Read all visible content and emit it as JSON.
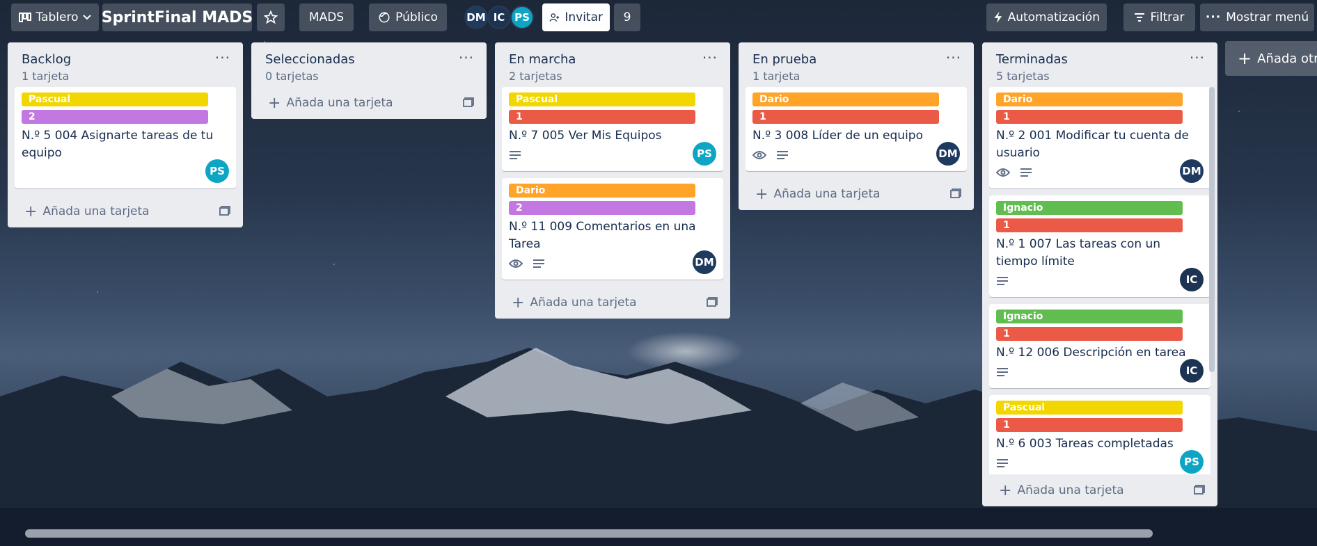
{
  "header": {
    "view_label": "Tablero",
    "board_title": "SprintFinal MADS",
    "workspace": "MADS",
    "visibility": "Público",
    "members": [
      {
        "initials": "DM",
        "color": "#1f3a5f"
      },
      {
        "initials": "IC",
        "color": "#1c3452"
      },
      {
        "initials": "PS",
        "color": "#0ea5c4"
      }
    ],
    "invite_label": "Invitar",
    "member_count": "9",
    "automation_label": "Automatización",
    "filter_label": "Filtrar",
    "menu_label": "Mostrar menú"
  },
  "add_list_label": "Añada otra",
  "add_card_label": "Añada una tarjeta",
  "label_colors": {
    "yellow": "#f2d600",
    "purple": "#c377e0",
    "red": "#eb5a46",
    "orange": "#ffa428",
    "green": "#61bd4f"
  },
  "lists": [
    {
      "title": "Backlog",
      "count": "1 tarjeta",
      "cards": [
        {
          "labels": [
            {
              "text": "Pascual",
              "color": "yellow"
            },
            {
              "text": "2",
              "color": "purple"
            }
          ],
          "title": "N.º 5 004 Asignarte tareas de tu equipo",
          "badges": [],
          "avatar": "PS"
        }
      ]
    },
    {
      "title": "Seleccionadas",
      "count": "0 tarjetas",
      "cards": []
    },
    {
      "title": "En marcha",
      "count": "2 tarjetas",
      "cards": [
        {
          "labels": [
            {
              "text": "Pascual",
              "color": "yellow"
            },
            {
              "text": "1",
              "color": "red"
            }
          ],
          "title": "N.º 7 005 Ver Mis Equipos",
          "badges": [
            "description-icon"
          ],
          "avatar": "PS"
        },
        {
          "labels": [
            {
              "text": "Dario",
              "color": "orange"
            },
            {
              "text": "2",
              "color": "purple"
            }
          ],
          "title": "N.º 11 009 Comentarios en una Tarea",
          "badges": [
            "watch-icon",
            "description-icon"
          ],
          "avatar": "DM"
        }
      ]
    },
    {
      "title": "En prueba",
      "count": "1 tarjeta",
      "cards": [
        {
          "labels": [
            {
              "text": "Dario",
              "color": "orange"
            },
            {
              "text": "1",
              "color": "red"
            }
          ],
          "title": "N.º 3 008 Líder de un equipo",
          "badges": [
            "watch-icon",
            "description-icon"
          ],
          "avatar": "DM"
        }
      ]
    },
    {
      "title": "Terminadas",
      "count": "5 tarjetas",
      "cards": [
        {
          "labels": [
            {
              "text": "Dario",
              "color": "orange"
            },
            {
              "text": "1",
              "color": "red"
            }
          ],
          "title": "N.º 2 001 Modificar tu cuenta de usuario",
          "badges": [
            "watch-icon",
            "description-icon"
          ],
          "avatar": "DM"
        },
        {
          "labels": [
            {
              "text": "Ignacio",
              "color": "green"
            },
            {
              "text": "1",
              "color": "red"
            }
          ],
          "title": "N.º 1 007 Las tareas con un tiempo límite",
          "badges": [
            "description-icon"
          ],
          "avatar": "IC"
        },
        {
          "labels": [
            {
              "text": "Ignacio",
              "color": "green"
            },
            {
              "text": "1",
              "color": "red"
            }
          ],
          "title": "N.º 12 006 Descripción en tarea",
          "badges": [
            "description-icon"
          ],
          "avatar": "IC"
        },
        {
          "labels": [
            {
              "text": "Pascual",
              "color": "yellow"
            },
            {
              "text": "1",
              "color": "red"
            }
          ],
          "title": "N.º 6 003 Tareas completadas",
          "badges": [
            "description-icon"
          ],
          "avatar": "PS"
        }
      ]
    }
  ]
}
